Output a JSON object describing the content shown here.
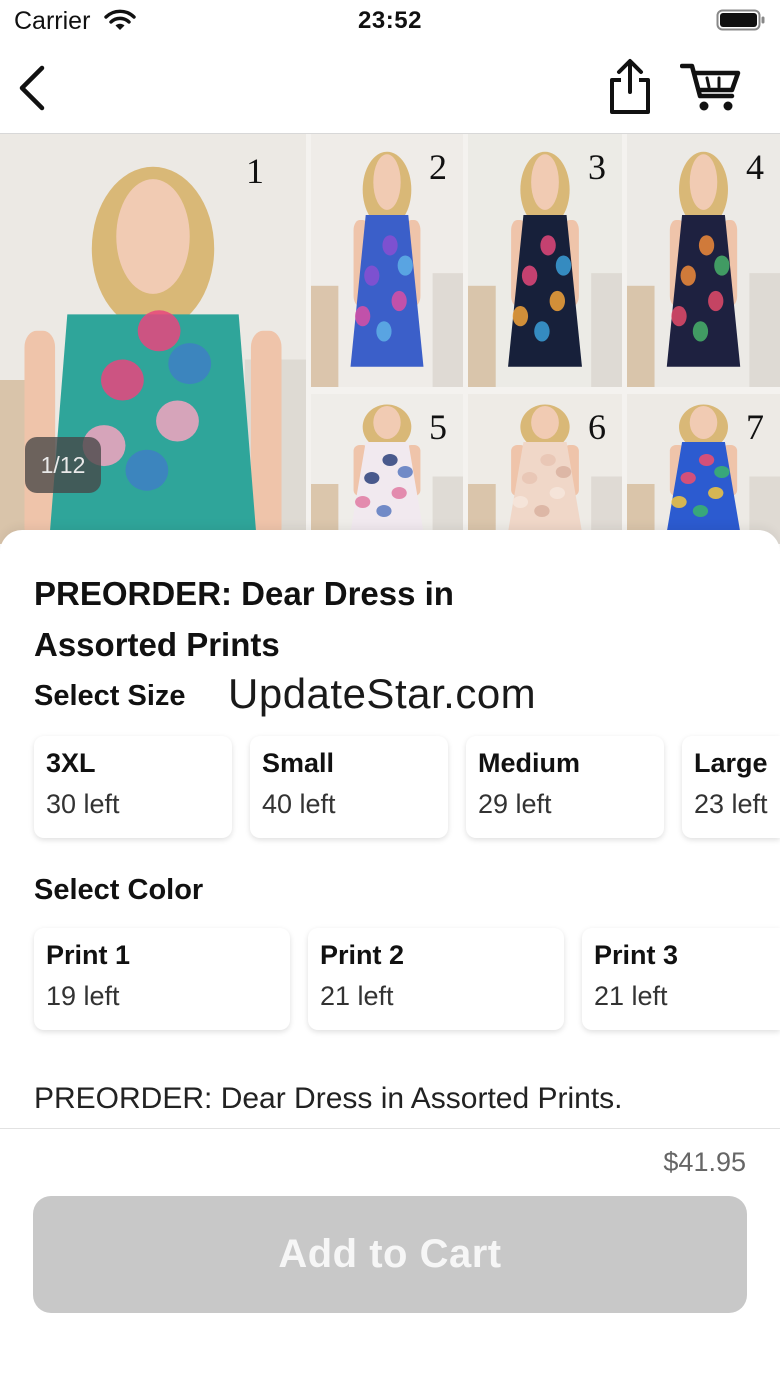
{
  "status_bar": {
    "carrier": "Carrier",
    "time": "23:52",
    "icons": [
      "wifi-icon",
      "battery-icon"
    ]
  },
  "nav": {
    "icons": [
      "chevron-left-icon",
      "share-icon",
      "cart-icon"
    ]
  },
  "gallery": {
    "counter": "1/12",
    "photos": [
      {
        "number": "1",
        "print_colors": [
          "#2fa59a",
          "#e8457e",
          "#f3a3c0",
          "#3e7fc4"
        ],
        "wall": "#ece9e4"
      },
      {
        "number": "2",
        "print_colors": [
          "#3b5fc9",
          "#8a4fd1",
          "#d94fa4",
          "#5fb0e6"
        ],
        "wall": "#efece8"
      },
      {
        "number": "3",
        "print_colors": [
          "#17203a",
          "#e3487a",
          "#f2a33a",
          "#3b9fd8"
        ],
        "wall": "#ecebe6"
      },
      {
        "number": "4",
        "print_colors": [
          "#1e2140",
          "#f08a3a",
          "#e34a6a",
          "#48b06a"
        ],
        "wall": "#eceae6"
      },
      {
        "number": "5",
        "print_colors": [
          "#f1e9ef",
          "#2b3f7a",
          "#e07aa2",
          "#5a79c0"
        ],
        "wall": "#efede9"
      },
      {
        "number": "6",
        "print_colors": [
          "#f0d7c8",
          "#e8c4b3",
          "#f6e6dc",
          "#d9b2a0"
        ],
        "wall": "#eeebe6"
      },
      {
        "number": "7",
        "print_colors": [
          "#2c5bd0",
          "#f14f6b",
          "#f5c73d",
          "#3bb56c"
        ],
        "wall": "#edeae5"
      }
    ]
  },
  "product": {
    "title": "PREORDER: Dear Dress in Assorted Prints",
    "description": "PREORDER: Dear Dress in Assorted Prints.",
    "price": "$41.95"
  },
  "size_section": {
    "label": "Select Size",
    "options": [
      {
        "name": "3XL",
        "stock": "30 left"
      },
      {
        "name": "Small",
        "stock": "40 left"
      },
      {
        "name": "Medium",
        "stock": "29 left"
      },
      {
        "name": "Large",
        "stock": "23 left"
      }
    ]
  },
  "color_section": {
    "label": "Select Color",
    "options": [
      {
        "name": "Print 1",
        "stock": "19 left"
      },
      {
        "name": "Print 2",
        "stock": "21 left"
      },
      {
        "name": "Print 3",
        "stock": "21 left"
      }
    ]
  },
  "watermark": "UpdateStar.com",
  "footer": {
    "add_to_cart_label": "Add to Cart"
  },
  "colors": {
    "button_disabled": "#c8c8c8",
    "price_text": "#666666"
  }
}
